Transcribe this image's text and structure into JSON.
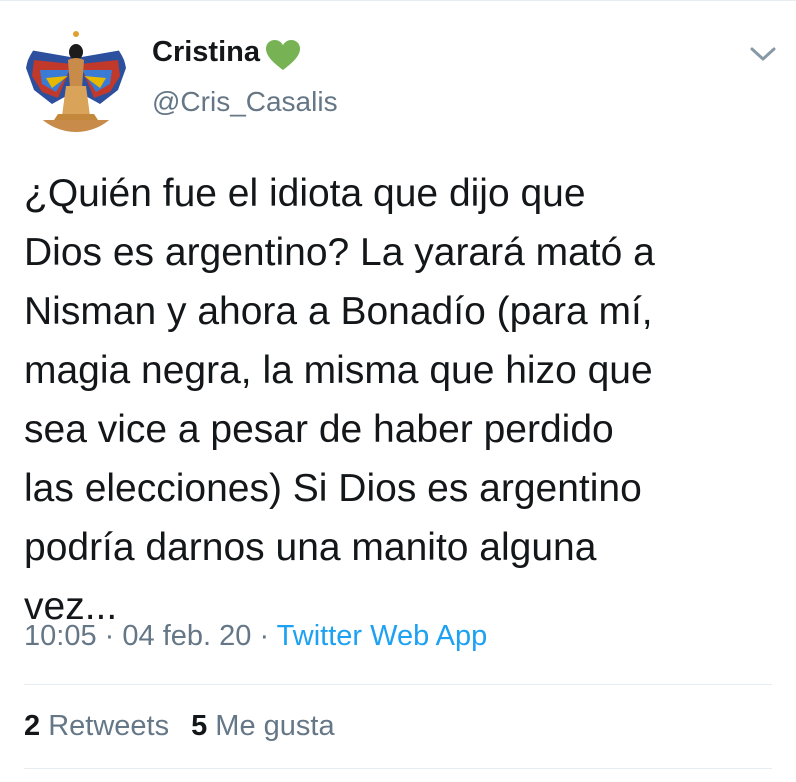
{
  "user": {
    "display_name": "Cristina",
    "handle": "@Cris_Casalis",
    "badge_icon": "green-heart-icon",
    "badge_color": "#77b255"
  },
  "tweet": {
    "lines": [
      "¿Quién fue el idiota que dijo que",
      "Dios es argentino?  La yarará mató a",
      "Nisman y ahora a Bonadío (para mí,",
      "magia negra, la misma que hizo que",
      "sea vice a pesar de haber perdido",
      "las elecciones) Si Dios es argentino",
      "podría darnos una manito alguna",
      "vez..."
    ],
    "time": "10:05",
    "date": "04 feb. 20",
    "separator": "·",
    "source": "Twitter Web App"
  },
  "stats": {
    "retweets_count": "2",
    "retweets_label": "Retweets",
    "likes_count": "5",
    "likes_label": "Me gusta"
  },
  "colors": {
    "text": "#14171a",
    "muted": "#657786",
    "link": "#1da1f2",
    "divider": "#e6ecf0"
  }
}
